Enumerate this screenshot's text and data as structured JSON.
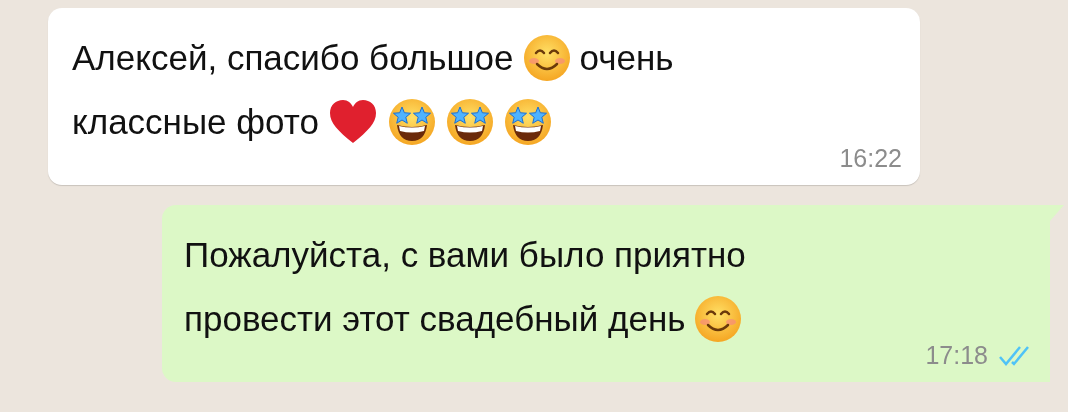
{
  "messages": [
    {
      "kind": "incoming",
      "lines": [
        [
          {
            "kind": "text",
            "text": "Алексей, спасибо большое"
          },
          {
            "kind": "smile"
          },
          {
            "kind": "text",
            "text": "очень"
          }
        ],
        [
          {
            "kind": "text",
            "text": "классные фото"
          },
          {
            "kind": "heart"
          },
          {
            "kind": "star-eyes"
          },
          {
            "kind": "star-eyes"
          },
          {
            "kind": "star-eyes"
          }
        ]
      ],
      "time": "16:22"
    },
    {
      "kind": "outgoing",
      "lines": [
        [
          {
            "kind": "text",
            "text": "Пожалуйста, с вами было приятно"
          }
        ],
        [
          {
            "kind": "text",
            "text": "провести этот свадебный день"
          },
          {
            "kind": "smile"
          }
        ]
      ],
      "time": "17:18",
      "read": true
    }
  ]
}
